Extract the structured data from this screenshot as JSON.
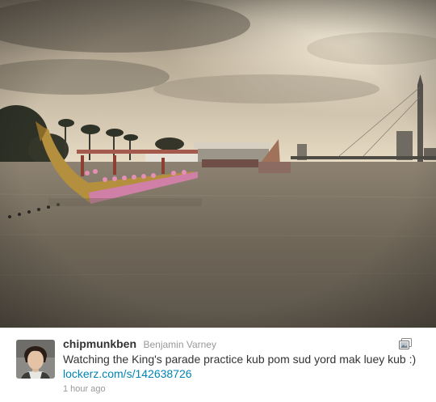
{
  "tweet": {
    "screen_name": "chipmunkben",
    "full_name": "Benjamin Varney",
    "text": "Watching the King's parade practice kub pom sud yord mak luey kub :)",
    "link": "lockerz.com/s/142638726",
    "timestamp": "1 hour ago"
  },
  "icons": {
    "media": "photo-media-icon",
    "avatar": "user-avatar"
  },
  "colors": {
    "link": "#0084b4",
    "screen_name": "#333333",
    "meta": "#999999"
  }
}
